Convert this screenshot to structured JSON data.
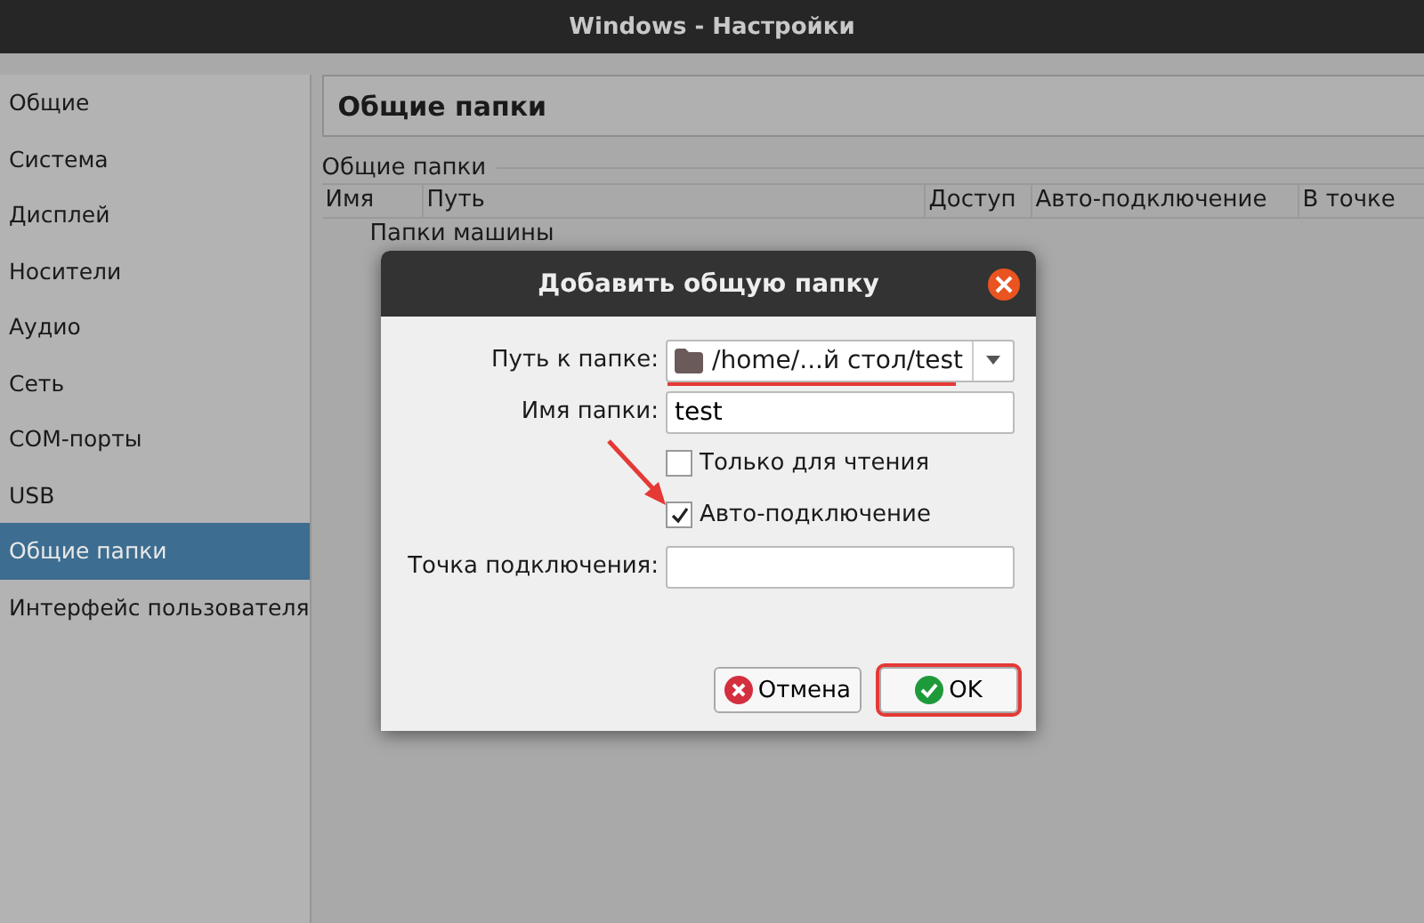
{
  "window": {
    "title": "Windows - Настройки"
  },
  "sidebar": {
    "items": [
      {
        "label": "Общие",
        "selected": false
      },
      {
        "label": "Система",
        "selected": false
      },
      {
        "label": "Дисплей",
        "selected": false
      },
      {
        "label": "Носители",
        "selected": false
      },
      {
        "label": "Аудио",
        "selected": false
      },
      {
        "label": "Сеть",
        "selected": false
      },
      {
        "label": "COM-порты",
        "selected": false
      },
      {
        "label": "USB",
        "selected": false
      },
      {
        "label": "Общие папки",
        "selected": true
      },
      {
        "label": "Интерфейс пользователя",
        "selected": false
      }
    ]
  },
  "page": {
    "title": "Общие папки",
    "group_label": "Общие папки",
    "table": {
      "columns": [
        "Имя",
        "Путь",
        "Доступ",
        "Авто-подключение",
        "В точке"
      ],
      "rows": [
        {
          "label": "Папки машины"
        }
      ]
    }
  },
  "dialog": {
    "title": "Добавить общую папку",
    "rows": [
      {
        "kind": "combo",
        "label": "Путь к папке:",
        "value": "/home/...й стол/test"
      },
      {
        "kind": "text",
        "label": "Имя папки:",
        "value": "test"
      },
      {
        "kind": "checkbox",
        "label": "Только для чтения",
        "checked": false
      },
      {
        "kind": "checkbox",
        "label": "Авто-подключение",
        "checked": true
      },
      {
        "kind": "text",
        "label": "Точка подключения:",
        "value": ""
      }
    ],
    "buttons": [
      {
        "kind": "cancel",
        "label": "Отмена",
        "highlighted": false
      },
      {
        "kind": "ok",
        "label": "OK",
        "highlighted": true
      }
    ]
  }
}
